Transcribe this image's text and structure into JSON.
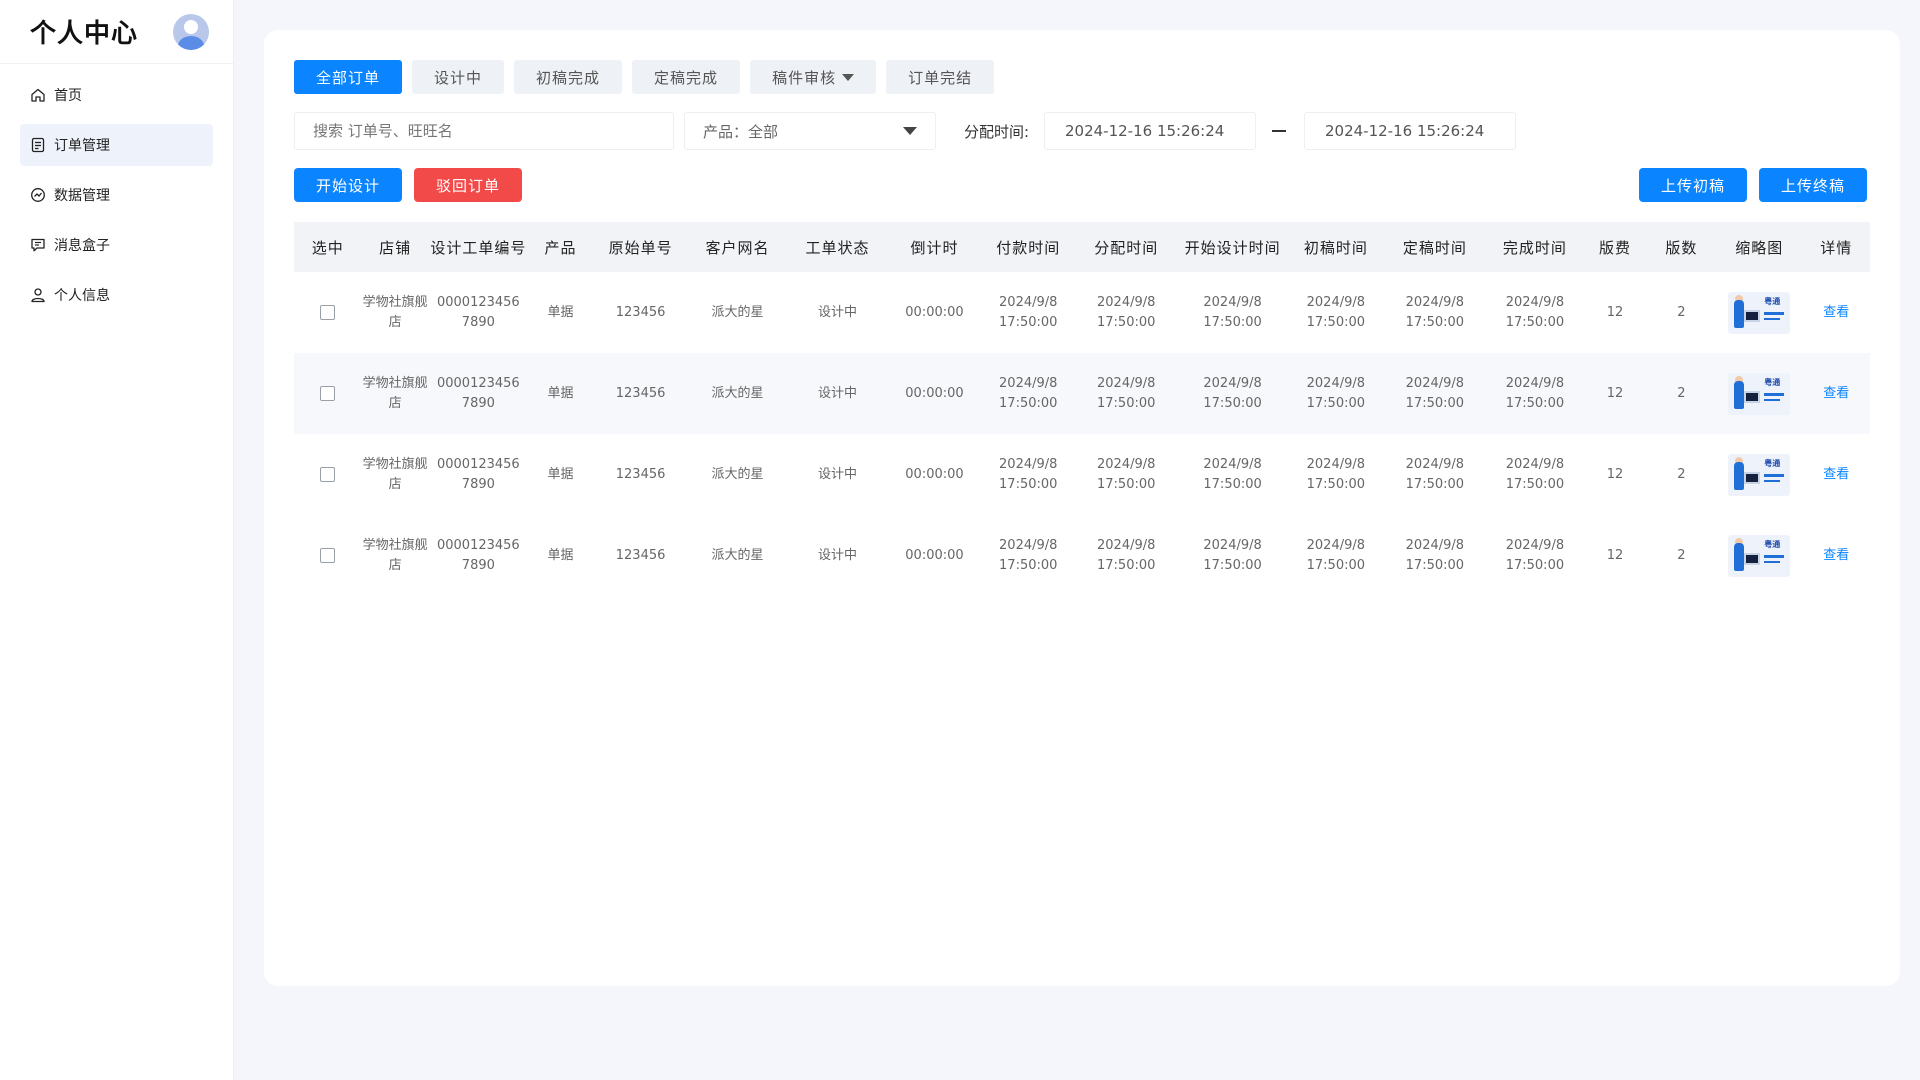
{
  "sidebar": {
    "title": "个人中心",
    "nav": [
      {
        "label": "首页",
        "icon": "home-icon",
        "active": false
      },
      {
        "label": "订单管理",
        "icon": "document-icon",
        "active": true
      },
      {
        "label": "数据管理",
        "icon": "chart-circle-icon",
        "active": false
      },
      {
        "label": "消息盒子",
        "icon": "message-icon",
        "active": false
      },
      {
        "label": "个人信息",
        "icon": "user-icon",
        "active": false
      }
    ]
  },
  "tabs": [
    "全部订单",
    "设计中",
    "初稿完成",
    "定稿完成",
    "稿件审核",
    "订单完结"
  ],
  "filters": {
    "search_placeholder": "搜索 订单号、旺旺名",
    "product_select": "产品：全部",
    "time_label": "分配时间:",
    "start_date": "2024-12-16 15:26:24",
    "end_date": "2024-12-16 15:26:24"
  },
  "actions": {
    "start_design": "开始设计",
    "reject_order": "驳回订单",
    "upload_draft": "上传初稿",
    "upload_final": "上传终稿"
  },
  "table": {
    "headers": [
      "选中",
      "店铺",
      "设计工单编号",
      "产品",
      "原始单号",
      "客户网名",
      "工单状态",
      "倒计时",
      "付款时间",
      "分配时间",
      "开始设计时间",
      "初稿时间",
      "定稿时间",
      "完成时间",
      "版费",
      "版数",
      "缩略图",
      "详情"
    ],
    "rows": [
      {
        "shop_1": "学物社旗舰",
        "shop_2": "店",
        "ticket_1": "0000123456",
        "ticket_2": "7890",
        "product": "单据",
        "order_no": "123456",
        "customer": "派大的星",
        "status": "设计中",
        "countdown": "00:00:00",
        "pay_d": "2024/9/8",
        "pay_t": "17:50:00",
        "assign_d": "2024/9/8",
        "assign_t": "17:50:00",
        "start_d": "2024/9/8",
        "start_t": "17:50:00",
        "draft_d": "2024/9/8",
        "draft_t": "17:50:00",
        "final_d": "2024/9/8",
        "final_t": "17:50:00",
        "done_d": "2024/9/8",
        "done_t": "17:50:00",
        "fee": "12",
        "versions": "2",
        "thumb_text_1": "粤通",
        "detail": "查看"
      },
      {
        "shop_1": "学物社旗舰",
        "shop_2": "店",
        "ticket_1": "0000123456",
        "ticket_2": "7890",
        "product": "单据",
        "order_no": "123456",
        "customer": "派大的星",
        "status": "设计中",
        "countdown": "00:00:00",
        "pay_d": "2024/9/8",
        "pay_t": "17:50:00",
        "assign_d": "2024/9/8",
        "assign_t": "17:50:00",
        "start_d": "2024/9/8",
        "start_t": "17:50:00",
        "draft_d": "2024/9/8",
        "draft_t": "17:50:00",
        "final_d": "2024/9/8",
        "final_t": "17:50:00",
        "done_d": "2024/9/8",
        "done_t": "17:50:00",
        "fee": "12",
        "versions": "2",
        "thumb_text_1": "粤通",
        "detail": "查看"
      },
      {
        "shop_1": "学物社旗舰",
        "shop_2": "店",
        "ticket_1": "0000123456",
        "ticket_2": "7890",
        "product": "单据",
        "order_no": "123456",
        "customer": "派大的星",
        "status": "设计中",
        "countdown": "00:00:00",
        "pay_d": "2024/9/8",
        "pay_t": "17:50:00",
        "assign_d": "2024/9/8",
        "assign_t": "17:50:00",
        "start_d": "2024/9/8",
        "start_t": "17:50:00",
        "draft_d": "2024/9/8",
        "draft_t": "17:50:00",
        "final_d": "2024/9/8",
        "final_t": "17:50:00",
        "done_d": "2024/9/8",
        "done_t": "17:50:00",
        "fee": "12",
        "versions": "2",
        "thumb_text_1": "粤通",
        "detail": "查看"
      },
      {
        "shop_1": "学物社旗舰",
        "shop_2": "店",
        "ticket_1": "0000123456",
        "ticket_2": "7890",
        "product": "单据",
        "order_no": "123456",
        "customer": "派大的星",
        "status": "设计中",
        "countdown": "00:00:00",
        "pay_d": "2024/9/8",
        "pay_t": "17:50:00",
        "assign_d": "2024/9/8",
        "assign_t": "17:50:00",
        "start_d": "2024/9/8",
        "start_t": "17:50:00",
        "draft_d": "2024/9/8",
        "draft_t": "17:50:00",
        "final_d": "2024/9/8",
        "final_t": "17:50:00",
        "done_d": "2024/9/8",
        "done_t": "17:50:00",
        "fee": "12",
        "versions": "2",
        "thumb_text_1": "粤通",
        "detail": "查看"
      }
    ]
  },
  "colors": {
    "primary": "#0a84ff",
    "danger": "#f24949",
    "status_green": "#1aa52a",
    "countdown_red": "#ef3333",
    "page_bg": "#f4f6fb"
  }
}
